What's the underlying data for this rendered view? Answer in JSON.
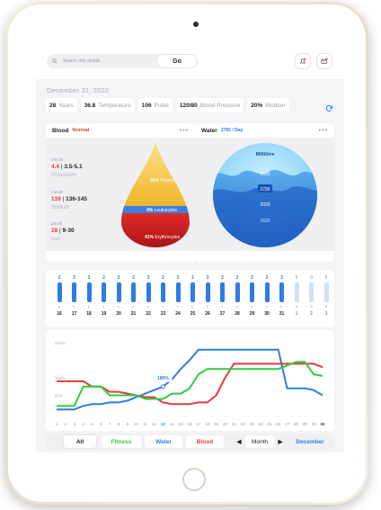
{
  "header": {
    "search_placeholder": "Search Info details",
    "go_label": "Go",
    "date": "December 31, 2022"
  },
  "stats": [
    {
      "value": "28",
      "label": "Years"
    },
    {
      "value": "36.8",
      "label": "Temperature"
    },
    {
      "value": "106",
      "label": "Pulse"
    },
    {
      "value": "120/80",
      "label": "Blood Pressure"
    },
    {
      "value": "20%",
      "label": "Blubber"
    }
  ],
  "blood": {
    "title": "Blood",
    "status": "Normal",
    "status_color": "#e53b3b",
    "rows": [
      {
        "unit": "mmol/l",
        "value": "4.4",
        "range": "3.5-5.1",
        "name": "Potassium",
        "highlight": true
      },
      {
        "unit": "mmol/l",
        "value": "139",
        "range": "136-145",
        "name": "Sodium",
        "highlight": true
      },
      {
        "unit": "µmol/l",
        "value": "28",
        "range": "9-30",
        "name": "Iron",
        "highlight": true
      }
    ],
    "drop": [
      {
        "pct": "55%",
        "label": "Plasma",
        "color": "#f2c230"
      },
      {
        "pct": "4%",
        "label": "Leukocytes",
        "color": "#3b7fe0"
      },
      {
        "pct": "41%",
        "label": "Erythrocytes",
        "color": "#d92525"
      }
    ]
  },
  "water": {
    "title": "Water",
    "daily": "2765 / Day",
    "unit_label": "Millilitre",
    "scale": [
      "3000",
      "2700",
      "2020",
      "1620"
    ]
  },
  "daily_bars": {
    "counts": [
      "2",
      "2",
      "3",
      "2",
      "2",
      "2",
      "3",
      "2",
      "2",
      "2",
      "3",
      "2",
      "2",
      "2",
      "3",
      "3",
      "0",
      "0",
      "0"
    ],
    "levels": [
      "L",
      "L",
      "L",
      "L",
      "L",
      "L",
      "L",
      "L",
      "L",
      "L",
      "L",
      "L",
      "L",
      "L",
      "L",
      "L",
      "1",
      "2",
      "3"
    ],
    "days": [
      "16",
      "17",
      "18",
      "19",
      "20",
      "21",
      "22",
      "23",
      "24",
      "25",
      "26",
      "27",
      "28",
      "29",
      "30",
      "31",
      "1",
      "2",
      "3"
    ],
    "active_color": "#2f7be6",
    "inactive_color": "#cfe0f7"
  },
  "chart_data": {
    "type": "line",
    "title": "",
    "xlabel": "",
    "ylabel": "",
    "x": [
      1,
      2,
      3,
      4,
      5,
      6,
      7,
      8,
      9,
      10,
      11,
      12,
      13,
      14,
      15,
      16,
      17,
      18,
      19,
      20,
      21,
      22,
      23,
      24,
      25,
      26,
      27,
      28,
      29,
      30,
      31
    ],
    "y_ticks": [
      "200%",
      "100%",
      "50%"
    ],
    "highlight_x": 13,
    "highlight_label": "180%",
    "series": [
      {
        "color": "#2f7be6",
        "values": [
          20,
          20,
          20,
          30,
          35,
          35,
          40,
          40,
          45,
          55,
          65,
          75,
          85,
          105,
          135,
          160,
          190,
          190,
          190,
          190,
          190,
          190,
          190,
          190,
          190,
          190,
          80,
          80,
          80,
          75,
          60,
          60
        ]
      },
      {
        "color": "#e53b3b",
        "values": [
          100,
          100,
          100,
          100,
          85,
          85,
          70,
          70,
          65,
          60,
          55,
          55,
          40,
          35,
          35,
          35,
          40,
          40,
          60,
          110,
          150,
          150,
          150,
          150,
          150,
          150,
          150,
          150,
          150,
          150,
          140,
          150
        ]
      },
      {
        "color": "#2ecc40",
        "values": [
          30,
          30,
          30,
          85,
          85,
          85,
          60,
          60,
          60,
          60,
          50,
          50,
          50,
          65,
          65,
          80,
          120,
          135,
          135,
          135,
          135,
          135,
          135,
          135,
          135,
          135,
          145,
          155,
          155,
          120,
          115,
          125
        ]
      }
    ],
    "ylim": [
      0,
      220
    ]
  },
  "bottom_tabs": {
    "items": [
      {
        "label": "All",
        "color": "#222222",
        "active": true
      },
      {
        "label": "Fitness",
        "color": "#2ecc40",
        "active": false
      },
      {
        "label": "Water",
        "color": "#2f7be6",
        "active": false
      },
      {
        "label": "Blood",
        "color": "#e53b3b",
        "active": false
      }
    ],
    "period_label": "Month",
    "month_label": "December"
  }
}
